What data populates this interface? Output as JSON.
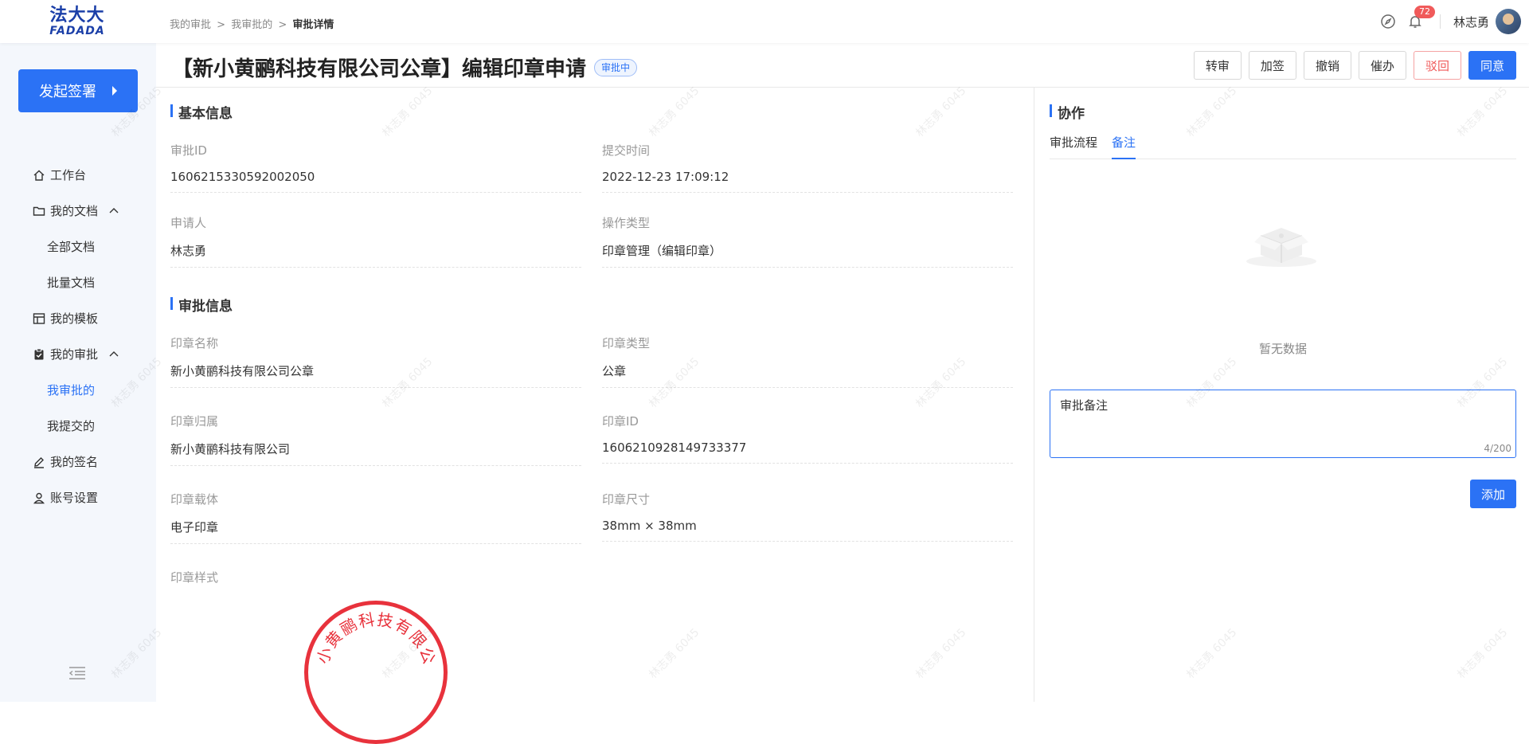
{
  "logo": {
    "cn": "法大大",
    "en": "FADADA"
  },
  "breadcrumb": {
    "l1": "我的审批",
    "l2": "我审批的",
    "current": "审批详情",
    "sep": ">"
  },
  "top": {
    "badge": "72",
    "username": "林志勇"
  },
  "sidebar": {
    "start_label": "发起签署",
    "items": [
      {
        "label": "工作台"
      },
      {
        "label": "我的文档"
      },
      {
        "label": "全部文档"
      },
      {
        "label": "批量文档"
      },
      {
        "label": "我的模板"
      },
      {
        "label": "我的审批"
      },
      {
        "label": "我审批的"
      },
      {
        "label": "我提交的"
      },
      {
        "label": "我的签名"
      },
      {
        "label": "账号设置"
      }
    ]
  },
  "page": {
    "title": "【新小黄鹂科技有限公司公章】编辑印章申请",
    "status": "审批中"
  },
  "actions": {
    "transfer": "转审",
    "add_sign": "加签",
    "revoke": "撤销",
    "urge": "催办",
    "reject": "驳回",
    "agree": "同意"
  },
  "basic": {
    "title": "基本信息",
    "approval_id_label": "审批ID",
    "approval_id": "1606215330592002050",
    "submit_time_label": "提交时间",
    "submit_time": "2022-12-23 17:09:12",
    "applicant_label": "申请人",
    "applicant": "林志勇",
    "op_type_label": "操作类型",
    "op_type": "印章管理（编辑印章）"
  },
  "approval": {
    "title": "审批信息",
    "seal_name_label": "印章名称",
    "seal_name": "新小黄鹂科技有限公司公章",
    "seal_type_label": "印章类型",
    "seal_type": "公章",
    "seal_owner_label": "印章归属",
    "seal_owner": "新小黄鹂科技有限公司",
    "seal_id_label": "印章ID",
    "seal_id": "1606210928149733377",
    "carrier_label": "印章载体",
    "carrier": "电子印章",
    "size_label": "印章尺寸",
    "size": "38mm × 38mm",
    "style_label": "印章样式",
    "seal_chars": [
      "小",
      "黄",
      "鹂",
      "科",
      "技",
      "有",
      "限",
      "公"
    ]
  },
  "collab": {
    "title": "协作",
    "tab_flow": "审批流程",
    "tab_remark": "备注",
    "empty": "暂无数据",
    "remark_value": "审批备注",
    "counter": "4/200",
    "add_label": "添加"
  },
  "watermark": "林志勇 6045",
  "colors": {
    "accent": "#2b72f5",
    "danger": "#f05a5a",
    "seal": "#e8323c"
  }
}
